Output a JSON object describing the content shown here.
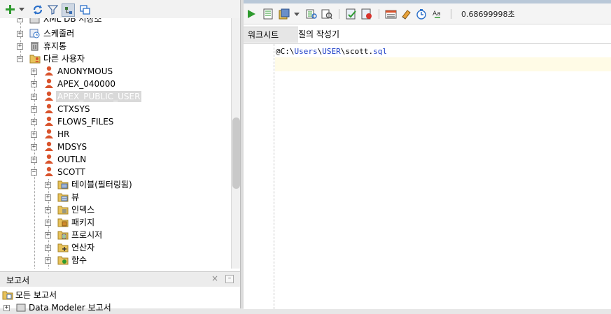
{
  "left_toolbar": {
    "icons": [
      "add-icon",
      "dropdown-icon",
      "refresh-icon",
      "filter-icon",
      "schema-browser-icon",
      "new-window-icon"
    ]
  },
  "tree": {
    "partial_top_label": "XML DB 저장소",
    "items": {
      "scheduler": "스케줄러",
      "recycle_bin": "휴지통",
      "other_users": "다른 사용자",
      "anonymous": "ANONYMOUS",
      "apex_040000": "APEX_040000",
      "apex_public_user": "APEX_PUBLIC_USER",
      "ctxsys": "CTXSYS",
      "flows_files": "FLOWS_FILES",
      "hr": "HR",
      "mdsys": "MDSYS",
      "outln": "OUTLN",
      "scott": "SCOTT",
      "tables_filtered": "테이블(필터링됨)",
      "views": "뷰",
      "indexes": "인덱스",
      "packages": "패키지",
      "procedures": "프로시저",
      "operators": "연산자",
      "functions": "함수"
    },
    "selected_item": "APEX_PUBLIC_USER"
  },
  "reports": {
    "title": "보고서",
    "close_glyph": "×",
    "minimize_glyph": "–",
    "all_reports": "모든 보고서",
    "data_modeler_reports": "Data Modeler 보고서"
  },
  "right_toolbar": {
    "execution_time": "0.68699998초"
  },
  "tabs": {
    "worksheet": "워크시트",
    "query_builder": "질의 작성기"
  },
  "editor": {
    "at": "@",
    "drive": "C:",
    "sep": "\\",
    "users": "Users",
    "user": "USER",
    "file_base": "scott.",
    "file_ext": "sql"
  },
  "colors": {
    "user_icon": "#d9532c",
    "folder": "#e8c25a",
    "run_green": "#2e9a2e",
    "code_blue": "#1a3cc8"
  }
}
